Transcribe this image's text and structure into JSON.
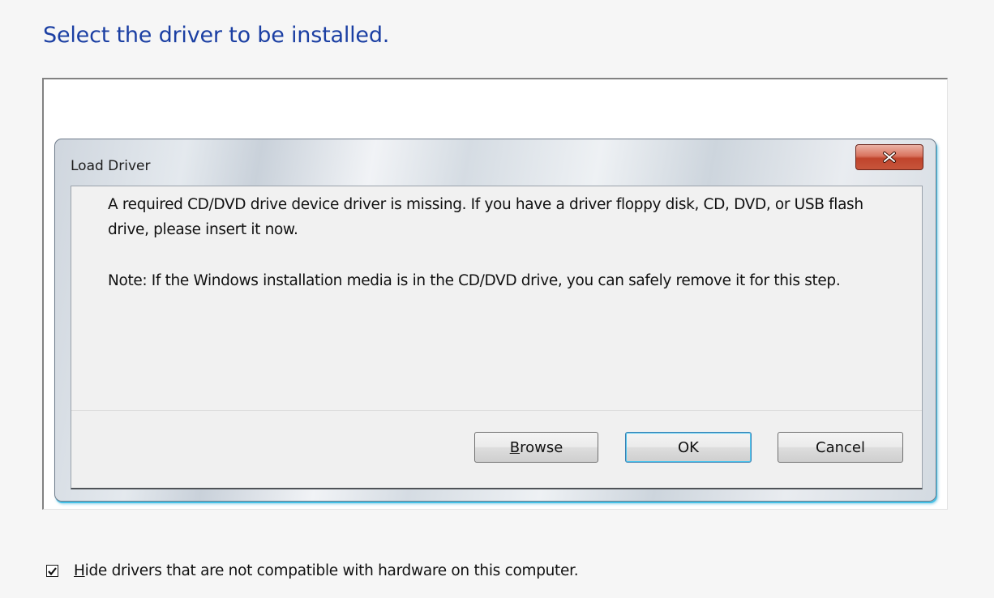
{
  "page": {
    "title": "Select the driver to be installed."
  },
  "dialog": {
    "title": "Load Driver",
    "close_icon": "close-x-icon",
    "message_line_1": "A required CD/DVD drive device driver is missing. If you have a driver floppy disk, CD, DVD, or USB flash drive, please insert it now.",
    "message_line_2": "Note: If the Windows installation media is in the CD/DVD drive, you can safely remove it for this step.",
    "buttons": {
      "browse_accel": "B",
      "browse_rest": "rowse",
      "ok": "OK",
      "cancel": "Cancel"
    }
  },
  "options": {
    "hide_incompatible": {
      "checked": true,
      "label_accel": "H",
      "label_rest": "ide drivers that are not compatible with hardware on this computer."
    }
  },
  "colors": {
    "title_blue": "#1b3fa3",
    "close_red": "#c7553b",
    "focus_cyan": "#45c1e7"
  }
}
